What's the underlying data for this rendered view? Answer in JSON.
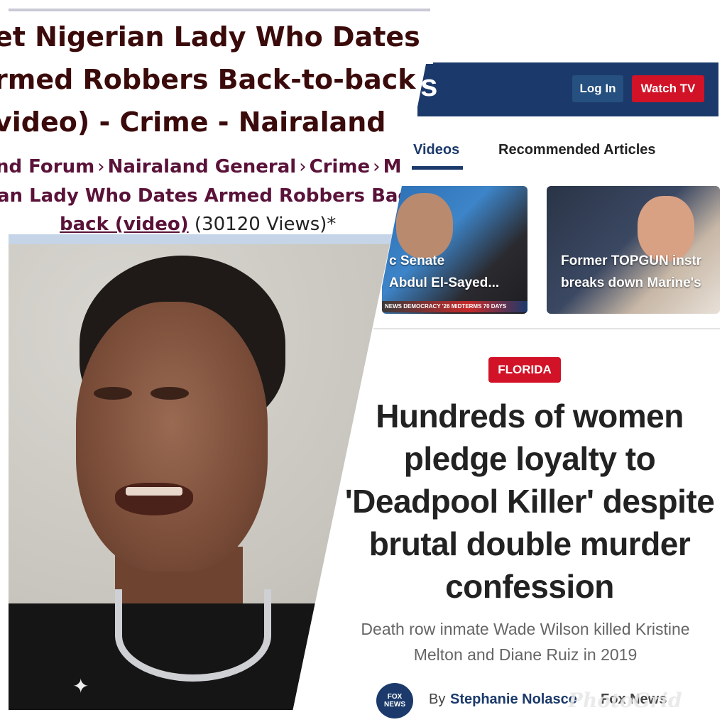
{
  "nairaland": {
    "title_lines": [
      "et Nigerian Lady Who Dates",
      "rmed Robbers Back-to-back",
      "video) - Crime - Nairaland"
    ],
    "breadcrumb": {
      "items": [
        "nd Forum",
        "Nairaland General",
        "Crime",
        "M"
      ],
      "separator": "›"
    },
    "topic_line": "an Lady Who Dates Armed Robbers Back-",
    "topic_link": "back (video)",
    "views": "(30120 Views)*"
  },
  "fox": {
    "logo_fragment": "s",
    "buttons": {
      "login": "Log In",
      "watch": "Watch TV"
    },
    "tabs": [
      "Videos",
      "Recommended Articles"
    ],
    "cards": [
      {
        "caption_lines": [
          "c Senate",
          "Abdul El-Sayed..."
        ],
        "ticker": "NEWS  DEMOCRACY  '26  MIDTERMS  70 DAYS"
      },
      {
        "caption_lines": [
          "Former TOPGUN instr",
          "breaks down Marine's"
        ]
      }
    ],
    "kicker": "FLORIDA",
    "headline": "Hundreds of women pledge loyalty to 'Deadpool Killer' despite brutal double murder confession",
    "subhead": "Death row inmate Wade Wilson killed Kristine Melton and Diane Ruiz in 2019",
    "byline": {
      "by": "By",
      "author": "Stephanie Nolasco",
      "outlet": "Fox News",
      "avatar_text": "FOX NEWS"
    }
  },
  "watermark": "PhotoGrid",
  "colors": {
    "fox_blue": "#1b3a6b",
    "fox_red": "#d11227",
    "nairaland_maroon": "#5a1239"
  }
}
